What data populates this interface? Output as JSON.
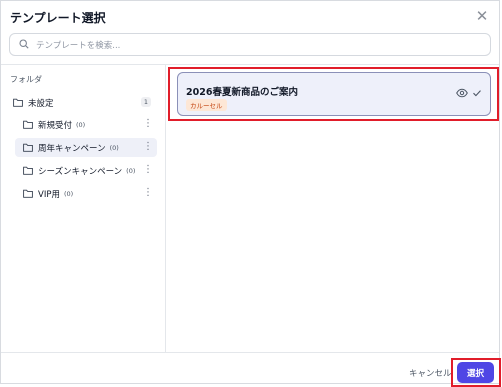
{
  "dialog": {
    "title": "テンプレート選択"
  },
  "search": {
    "placeholder": "テンプレートを検索..."
  },
  "sidebar": {
    "label": "フォルダ",
    "folders": [
      {
        "name": "未設定",
        "count": "1"
      },
      {
        "name": "新規受付",
        "count": "(0)"
      },
      {
        "name": "周年キャンペーン",
        "count": "(0)",
        "selected": true
      },
      {
        "name": "シーズンキャンペーン",
        "count": "(0)"
      },
      {
        "name": "VIP用",
        "count": "(0)"
      }
    ]
  },
  "templates": [
    {
      "title": "2026春夏新商品のご案内",
      "tag": "カルーセル"
    }
  ],
  "footer": {
    "cancel_label": "キャンセル",
    "select_label": "選択"
  },
  "colors": {
    "accent": "#4f46e5",
    "highlight": "#e11d2a",
    "card_bg": "#eef0fa"
  },
  "icons": [
    "close-icon",
    "search-icon",
    "folder-icon",
    "more-vert-icon",
    "eye-icon",
    "check-icon"
  ]
}
